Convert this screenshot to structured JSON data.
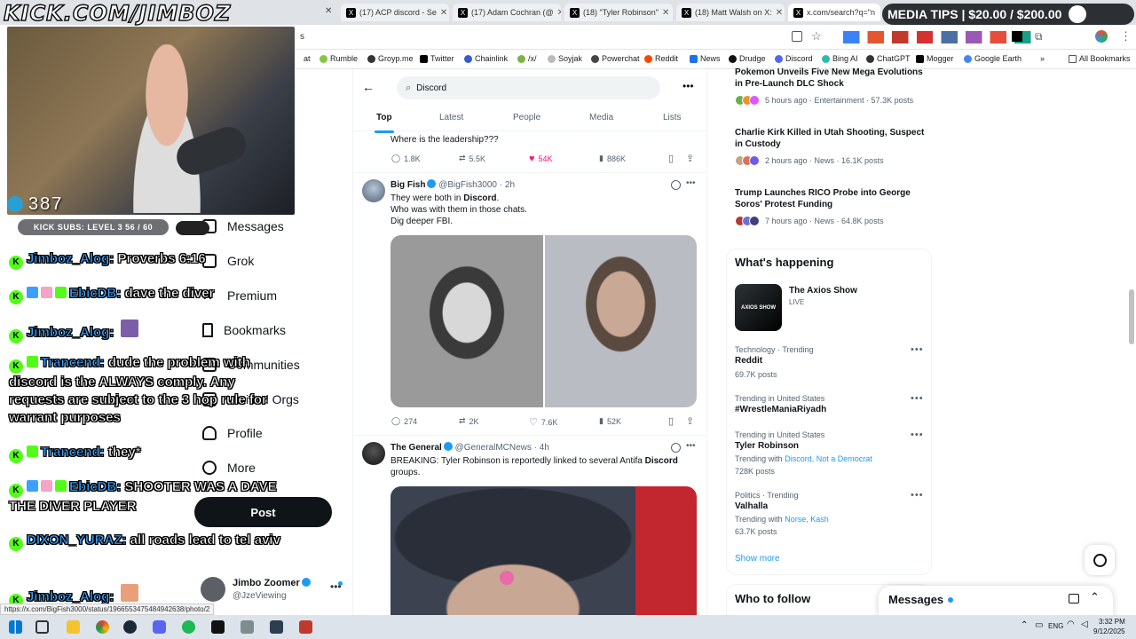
{
  "stream": {
    "banner": "KICK.COM/JIMBOZ",
    "media_tips": "MEDIA TIPS | $20.00 / $200.00",
    "viewer_count": "387",
    "subs_text": "KICK SUBS: LEVEL 3 56 / 60",
    "chat": [
      {
        "user": "Jimboz_Alog:",
        "message": " Proverbs 6:16"
      },
      {
        "user": "EbicDB:",
        "message": " dave the diver"
      },
      {
        "user": "Jimboz_Alog:",
        "message": ""
      },
      {
        "user": "Trancend:",
        "message": " dude the problem with discord is the ALWAYS comply. Any requests are subject to the 3 hop rule for warrant purposes"
      },
      {
        "user": "Trancend:",
        "message": " they*"
      },
      {
        "user": "EbicDB:",
        "message": " SHOOTER WAS A DAVE THE DIVER PLAYER"
      },
      {
        "user": "DIXON_YURAZ:",
        "message": " all roads lead to tel aviv"
      },
      {
        "user": "Jimboz_Alog:",
        "message": ""
      }
    ]
  },
  "browser": {
    "tabs": [
      {
        "title": "(17) ACP discord - Se"
      },
      {
        "title": "(17) Adam Cochran (@"
      },
      {
        "title": "(18) \"Tyler Robinson\""
      },
      {
        "title": "(18) Matt Walsh on X:"
      },
      {
        "title": "x.com/search?q=\"n"
      }
    ],
    "url_fragment": "s",
    "bookmarks": [
      "at",
      "Rumble",
      "Groyp.me",
      "Twitter",
      "Chainlink",
      "/x/",
      "Soyjak",
      "Powerchat",
      "Reddit",
      "News",
      "Drudge",
      "Discord",
      "Bing AI",
      "ChatGPT",
      "Mogger",
      "Google Earth",
      "All Bookmarks"
    ],
    "status_url": "https://x.com/BigFish3000/status/1966553475484942638/photo/2"
  },
  "nav": {
    "items": [
      "Messages",
      "Grok",
      "Premium",
      "Bookmarks",
      "Communities",
      "Verified Orgs",
      "Profile",
      "More"
    ],
    "post_label": "Post",
    "account_name": "Jimbo Zoomer",
    "account_handle": "@JzeViewing"
  },
  "search": {
    "query": "Discord",
    "tabs": [
      "Top",
      "Latest",
      "People",
      "Media",
      "Lists"
    ]
  },
  "tweets": [
    {
      "text": "Where is the leadership???",
      "replies": "1.8K",
      "reposts": "5.5K",
      "likes": "54K",
      "views": "886K"
    },
    {
      "name": "Big Fish",
      "handle": "@BigFish3000",
      "time": "2h",
      "line1_pre": "They were both in ",
      "line1_bold": "Discord",
      "line1_post": ".",
      "line2": "Who was with them in those chats.",
      "line3": "Dig deeper FBI.",
      "replies": "274",
      "reposts": "2K",
      "likes": "7.6K",
      "views": "52K"
    },
    {
      "name": "The General",
      "handle": "@GeneralMCNews",
      "time": "4h",
      "text_pre": "BREAKING: Tyler Robinson is reportedly linked to several Antifa ",
      "text_bold": "Discord",
      "text_post": " groups."
    }
  ],
  "news": [
    {
      "title": "Pokemon Unveils Five New Mega Evolutions in Pre-Launch DLC Shock",
      "meta": "5 hours ago · Entertainment · 57.3K posts"
    },
    {
      "title": "Charlie Kirk Killed in Utah Shooting, Suspect in Custody",
      "meta": "2 hours ago · News · 16.1K posts"
    },
    {
      "title": "Trump Launches RICO Probe into George Soros' Protest Funding",
      "meta": "7 hours ago · News · 64.8K posts"
    }
  ],
  "happening": {
    "title": "What's happening",
    "live_name": "The Axios Show",
    "live_label": "LIVE",
    "thumb_text": "AXIOS SHOW",
    "trends": [
      {
        "category": "Technology · Trending",
        "name": "Reddit",
        "sub_pre": "",
        "links": "",
        "count": "69.7K posts"
      },
      {
        "category": "Trending in United States",
        "name": "#WrestleManiaRiyadh",
        "sub_pre": "",
        "links": "",
        "count": ""
      },
      {
        "category": "Trending in United States",
        "name": "Tyler Robinson",
        "sub_pre": "Trending with ",
        "links": "Discord, Not a Democrat",
        "count": "728K posts"
      },
      {
        "category": "Politics · Trending",
        "name": "Valhalla",
        "sub_pre": "Trending with ",
        "links": "Norse, Kash",
        "count": "63.7K posts"
      }
    ],
    "show_more": "Show more"
  },
  "who_to_follow": "Who to follow",
  "messages_drawer": "Messages",
  "clock": {
    "time": "3:32 PM",
    "date": "9/12/2025",
    "lang": "ENG"
  }
}
